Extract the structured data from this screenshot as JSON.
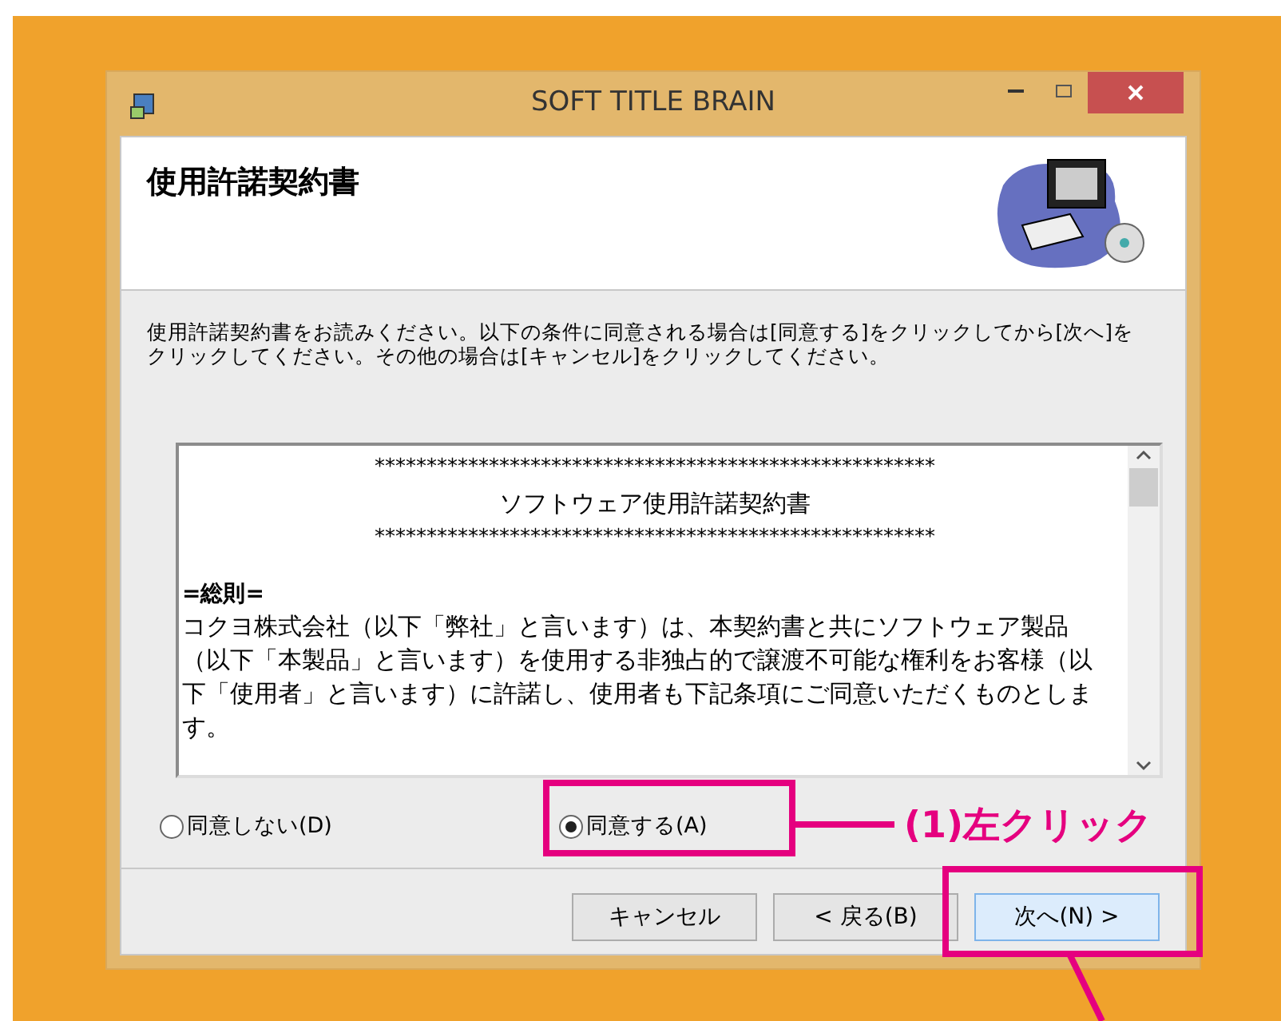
{
  "window": {
    "title": "SOFT TITLE BRAIN"
  },
  "header": {
    "title": "使用許諾契約書"
  },
  "instructions": "使用許諾契約書をお読みください。以下の条件に同意される場合は[同意する]をクリックしてから[次へ]をクリックしてください。その他の場合は[キャンセル]をクリックしてください。",
  "license": {
    "rule": "******************************************************",
    "title": "ソフトウェア使用許諾契約書",
    "rule_bottom": "******************************************************",
    "section": "=総則=",
    "paragraph": "コクヨ株式会社（以下「弊社」と言います）は、本契約書と共にソフトウェア製品（以下「本製品」と言います）を使用する非独占的で譲渡不可能な権利をお客様（以下「使用者」と言います）に許諾し、使用者も下記条項にご同意いただくものとします。"
  },
  "radios": [
    {
      "label": "同意しない(D)",
      "selected": false
    },
    {
      "label": "同意する(A)",
      "selected": true
    }
  ],
  "buttons": [
    {
      "label": "キャンセル",
      "default": false
    },
    {
      "label": "< 戻る(B)",
      "default": false
    },
    {
      "label": "次へ(N) >",
      "default": true
    }
  ],
  "annotation": {
    "label": "(1)左クリック"
  }
}
